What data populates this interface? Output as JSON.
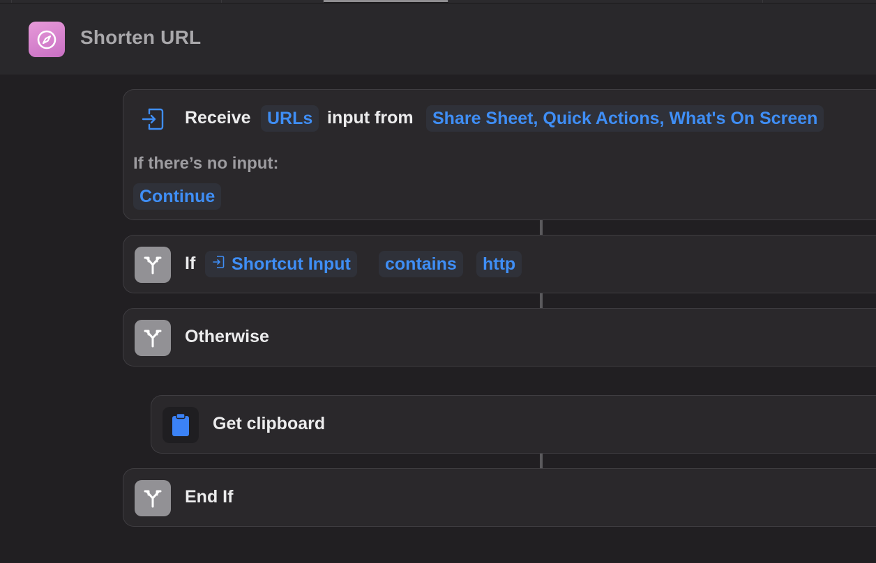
{
  "window": {
    "title": "Shorten URL",
    "icon": "compass-icon",
    "accent": "#d47fcf"
  },
  "actions": {
    "receive": {
      "verb": "Receive",
      "type_token": "URLs",
      "middle": "input from",
      "sources_token": "Share Sheet, Quick Actions, What's On Screen",
      "no_input_label": "If there’s no input:",
      "no_input_value": "Continue"
    },
    "if": {
      "keyword": "If",
      "variable_token": "Shortcut Input",
      "operator_token": "contains",
      "value_token": "http"
    },
    "otherwise": {
      "label": "Otherwise"
    },
    "get_clipboard": {
      "label": "Get clipboard"
    },
    "end_if": {
      "label": "End If"
    }
  },
  "colors": {
    "token_text": "#3f8ef5",
    "token_bg": "#2f3139",
    "branch_icon_bg": "#929195",
    "clipboard_icon": "#3b82f6"
  }
}
